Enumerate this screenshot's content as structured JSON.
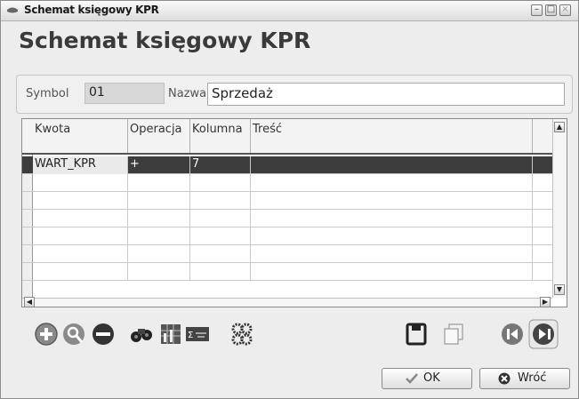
{
  "window": {
    "title": "Schemat księgowy KPR"
  },
  "heading": "Schemat księgowy KPR",
  "fields": {
    "symbol_label": "Symbol",
    "symbol_value": "01",
    "nazwa_label": "Nazwa",
    "nazwa_value": "Sprzedaż"
  },
  "grid": {
    "columns": [
      "Kwota",
      "Operacja",
      "Kolumna",
      "Treść"
    ],
    "rows": [
      {
        "kwota": "WART_KPR",
        "operacja": "+",
        "kolumna": "7",
        "tresc": ""
      }
    ],
    "empty_rows": 6,
    "selected_row": 0
  },
  "toolbar": {
    "icons": [
      "add-icon",
      "find-record-icon",
      "delete-icon",
      "search-binoculars-icon",
      "report-icon",
      "formula-icon",
      "settings-gears-icon",
      "save-icon",
      "copy-icon",
      "previous-icon",
      "next-icon"
    ]
  },
  "buttons": {
    "ok_label": "OK",
    "back_label": "Wróć"
  },
  "colors": {
    "selected_row": "#3c3c3c",
    "window_bg": "#ededed"
  }
}
